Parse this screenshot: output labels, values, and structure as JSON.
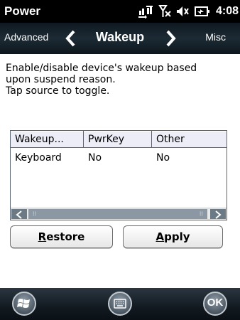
{
  "titlebar": {
    "app_title": "Power",
    "time": "4:08"
  },
  "navbar": {
    "prev_label": "Advanced",
    "title": "Wakeup",
    "next_label": "Misc"
  },
  "description": {
    "lines": [
      "Enable/disable device's wakeup based",
      "upon suspend reason.",
      "Tap source to toggle."
    ]
  },
  "listview": {
    "columns": [
      "Wakeup...",
      "PwrKey",
      "Other"
    ],
    "rows": [
      [
        "Keyboard",
        "No",
        "No"
      ]
    ]
  },
  "buttons": {
    "restore_mnemonic": "R",
    "restore_rest": "estore",
    "apply_mnemonic": "A",
    "apply_rest": "pply"
  },
  "bottombar": {
    "ok_label": "OK"
  },
  "colors": {
    "titlebar_bg": "#000000",
    "header_bg": "#ecedf7",
    "grid_line": "#5a6673"
  }
}
